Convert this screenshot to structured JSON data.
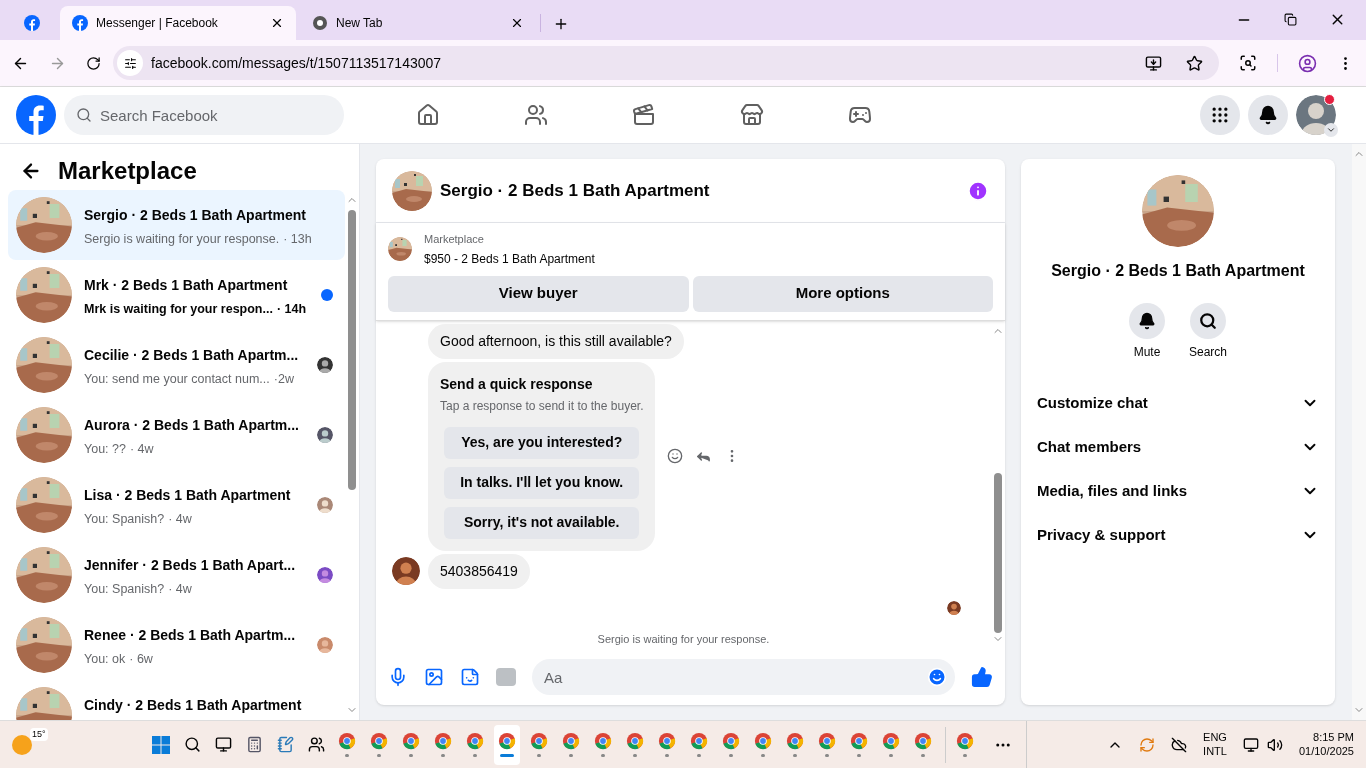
{
  "browser": {
    "tabs": [
      {
        "kind": "facebook",
        "label": "Messenger | Facebook",
        "selected": true
      },
      {
        "kind": "chrome",
        "label": "New Tab",
        "selected": false
      }
    ],
    "address": "facebook.com/messages/t/1507113517143007"
  },
  "facebook_header": {
    "search": {
      "placeholder": "Search Facebook"
    }
  },
  "sidebar": {
    "title": "Marketplace",
    "conversations": [
      {
        "title": "Sergio · 2 Beds 1 Bath Apartment",
        "preview": "Sergio is waiting for your response.",
        "time": "· 13h",
        "selected": true,
        "unread": false,
        "seen": false
      },
      {
        "title": "Mrk · 2 Beds 1 Bath Apartment",
        "preview": "Mrk is waiting for your respon...",
        "time": "· 14h",
        "selected": false,
        "unread": true,
        "seen": false
      },
      {
        "title": "Cecilie · 2 Beds 1 Bath Apartm...",
        "preview": "You: send me your contact num...",
        "time": "·2w",
        "selected": false,
        "unread": false,
        "seen": true
      },
      {
        "title": "Aurora · 2 Beds 1 Bath Apartm...",
        "preview": "You: ??",
        "time": "· 4w",
        "selected": false,
        "unread": false,
        "seen": true
      },
      {
        "title": "Lisa · 2 Beds 1 Bath Apartment",
        "preview": "You: Spanish?",
        "time": "· 4w",
        "selected": false,
        "unread": false,
        "seen": true
      },
      {
        "title": "Jennifer · 2 Beds 1 Bath Apart...",
        "preview": "You: Spanish?",
        "time": "· 4w",
        "selected": false,
        "unread": false,
        "seen": true
      },
      {
        "title": "Renee · 2 Beds 1 Bath Apartm...",
        "preview": "You: ok",
        "time": "· 6w",
        "selected": false,
        "unread": false,
        "seen": true
      },
      {
        "title": "Cindy · 2 Beds 1 Bath Apartment",
        "selected": false,
        "unread": false,
        "seen": false
      }
    ]
  },
  "chat": {
    "title": "Sergio · 2 Beds 1 Bath Apartment",
    "listing": {
      "label": "Marketplace",
      "name": "$950 - 2 Beds 1 Bath Apartment"
    },
    "buttons": [
      "View buyer",
      "More options"
    ],
    "messages": [
      {
        "kind": "text",
        "text": "Good afternoon, is this still available?",
        "avatar": false
      },
      {
        "kind": "quick_response",
        "title": "Send a quick response",
        "subtitle": "Tap a response to send it to the buyer.",
        "options": [
          "Yes, are you interested?",
          "In talks. I'll let you know.",
          "Sorry, it's not available."
        ]
      },
      {
        "kind": "text",
        "text": "5403856419",
        "avatar": true
      }
    ],
    "status": "Sergio is waiting for your response.",
    "composer": {
      "placeholder": "Aa"
    }
  },
  "details": {
    "title": "Sergio · 2 Beds 1 Bath Apartment",
    "actions": [
      {
        "kind": "bell",
        "label": "Mute"
      },
      {
        "kind": "search",
        "label": "Search"
      }
    ],
    "sections": [
      {
        "label": "Customize chat",
        "expanded": false
      },
      {
        "label": "Chat members",
        "expanded": false
      },
      {
        "label": "Media, files and links",
        "expanded": false
      },
      {
        "label": "Privacy & support",
        "expanded": false
      }
    ]
  },
  "taskbar": {
    "weather": "15°",
    "chrome_windows": [
      {
        "selected": false
      },
      {
        "selected": false
      },
      {
        "selected": false
      },
      {
        "selected": false
      },
      {
        "selected": false
      },
      {
        "selected": true
      },
      {
        "selected": false
      },
      {
        "selected": false
      },
      {
        "selected": false
      },
      {
        "selected": false
      },
      {
        "selected": false
      },
      {
        "selected": false
      },
      {
        "selected": false
      },
      {
        "selected": false
      },
      {
        "selected": false
      },
      {
        "selected": false
      },
      {
        "selected": false
      },
      {
        "selected": false
      },
      {
        "selected": false
      }
    ],
    "language": "ENG",
    "layout": "INTL",
    "time": "8:15 PM",
    "date": "01/10/2025"
  }
}
